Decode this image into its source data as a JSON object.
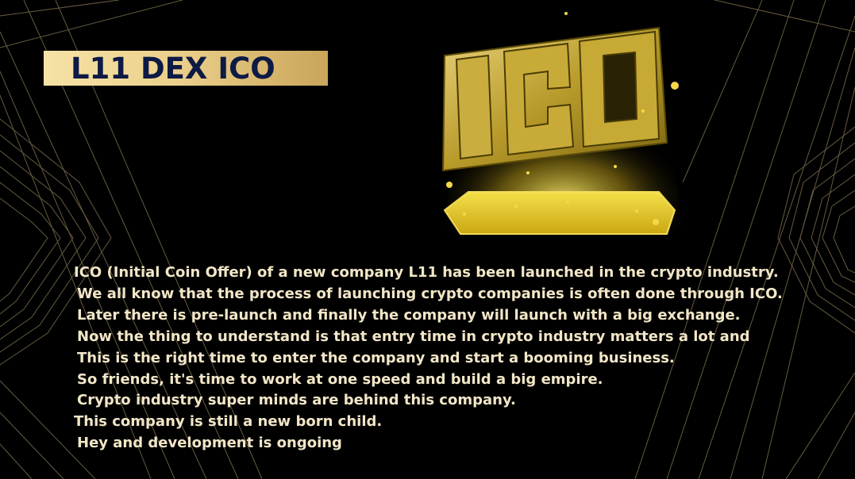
{
  "title": "L11 DEX ICO",
  "graphic": {
    "label": "ICO"
  },
  "paragraph": [
    "ICO (Initial Coin Offer) of a new company L11 has been launched in the crypto industry.",
    "We all know that the process of launching crypto companies is often done through ICO.",
    "Later there is pre-launch and finally the company will launch with a big exchange.",
    "Now the thing to understand is that entry time in crypto industry matters a lot and",
    "This is the right time to enter the company and start a booming business.",
    "So friends, it's time to work at one speed and build a big empire.",
    "Crypto industry super minds are behind this company.",
    "This company is still a new born child.",
    "Hey and development is ongoing"
  ],
  "colors": {
    "background": "#000000",
    "banner_light": "#f6e2a6",
    "banner_dark": "#caa55a",
    "title_text": "#0d1a45",
    "body_text": "#f2e6c7",
    "gold": "#d8b62a"
  }
}
